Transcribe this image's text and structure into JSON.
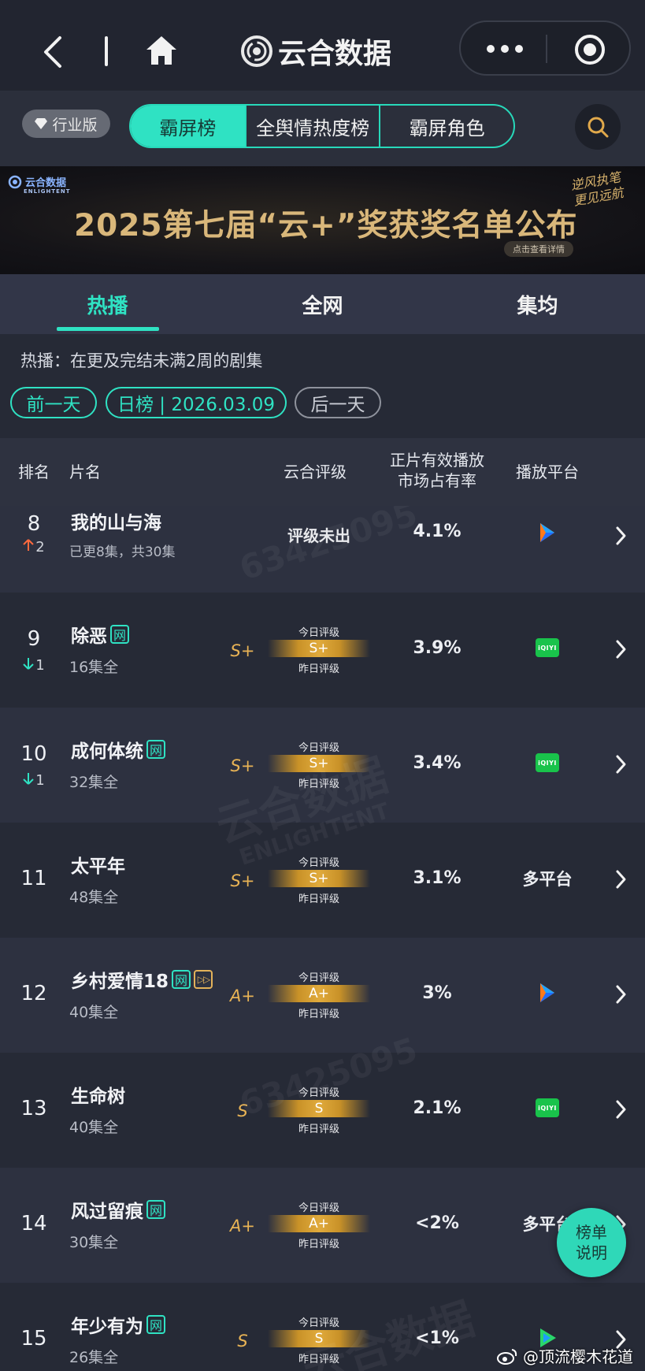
{
  "nav": {
    "title": "云合数据"
  },
  "tabs": {
    "industry_label": "行业版",
    "items": [
      "霸屏榜",
      "全舆情热度榜",
      "霸屏角色"
    ],
    "active": "霸屏榜"
  },
  "banner": {
    "title": "2025第七届“云+”奖获奖名单公布",
    "hint": "点击查看详情",
    "slogan": "逆风执笔 更见远航",
    "logo_text": "云合数据",
    "logo_sub": "ENLIGHTENT"
  },
  "subtabs": {
    "items": [
      "热播",
      "全网",
      "集均"
    ],
    "active": "热播"
  },
  "description": "热播：在更及完结未满2周的剧集",
  "date_nav": {
    "prev": "前一天",
    "current": "日榜 | 2026.03.09",
    "next": "后一天"
  },
  "table_header": {
    "rank": "排名",
    "name": "片名",
    "grade": "云合评级",
    "share_line1": "正片有效播放",
    "share_line2": "市场占有率",
    "platform": "播放平台"
  },
  "grade_labels": {
    "today": "今日评级",
    "yesterday": "昨日评级"
  },
  "rows": [
    {
      "rank": "8",
      "trend": "up",
      "trend_value": "2",
      "title": "我的山与海",
      "tag": "",
      "episodes": "已更8集，共30集",
      "grade_yesterday": "",
      "grade_today": "",
      "no_grade": "评级未出",
      "share": "4.1%",
      "platform": "tencent-video-icon",
      "platform_text": ""
    },
    {
      "rank": "9",
      "trend": "down",
      "trend_value": "1",
      "title": "除恶",
      "tag": "网",
      "episodes": "16集全",
      "grade_yesterday": "S+",
      "grade_today": "S+",
      "no_grade": "",
      "share": "3.9%",
      "platform": "iqiyi-icon",
      "platform_text": ""
    },
    {
      "rank": "10",
      "trend": "down",
      "trend_value": "1",
      "title": "成何体统",
      "tag": "网",
      "episodes": "32集全",
      "grade_yesterday": "S+",
      "grade_today": "S+",
      "no_grade": "",
      "share": "3.4%",
      "platform": "iqiyi-icon",
      "platform_text": ""
    },
    {
      "rank": "11",
      "trend": "",
      "trend_value": "",
      "title": "太平年",
      "tag": "",
      "episodes": "48集全",
      "grade_yesterday": "S+",
      "grade_today": "S+",
      "no_grade": "",
      "share": "3.1%",
      "platform": "",
      "platform_text": "多平台"
    },
    {
      "rank": "12",
      "trend": "",
      "trend_value": "",
      "title": "乡村爱情18",
      "tag": "网",
      "episodes": "40集全",
      "grade_yesterday": "A+",
      "grade_today": "A+",
      "no_grade": "",
      "share": "3%",
      "platform": "tencent-video-icon",
      "platform_text": ""
    },
    {
      "rank": "13",
      "trend": "",
      "trend_value": "",
      "title": "生命树",
      "tag": "",
      "episodes": "40集全",
      "grade_yesterday": "S",
      "grade_today": "S",
      "no_grade": "",
      "share": "2.1%",
      "platform": "iqiyi-icon",
      "platform_text": ""
    },
    {
      "rank": "14",
      "trend": "",
      "trend_value": "",
      "title": "风过留痕",
      "tag": "网",
      "episodes": "30集全",
      "grade_yesterday": "A+",
      "grade_today": "A+",
      "no_grade": "",
      "share": "<2%",
      "platform": "",
      "platform_text": "多平台"
    },
    {
      "rank": "15",
      "trend": "",
      "trend_value": "",
      "title": "年少有为",
      "tag": "网",
      "episodes": "26集全",
      "grade_yesterday": "S",
      "grade_today": "S",
      "no_grade": "",
      "share": "<1%",
      "platform": "tencent-video-icon",
      "platform_text": ""
    }
  ],
  "float_button": {
    "line1": "榜单",
    "line2": "说明"
  },
  "watermarks": {
    "id": "63425095",
    "brand": "云合数据",
    "brand_en": "ENLIGHTENT"
  },
  "weibo_credit": "@顶流樱木花道",
  "colors": {
    "accent": "#2fe2c3",
    "gold": "#e8b355",
    "up": "#ff6a3d",
    "background": "#262a36"
  }
}
